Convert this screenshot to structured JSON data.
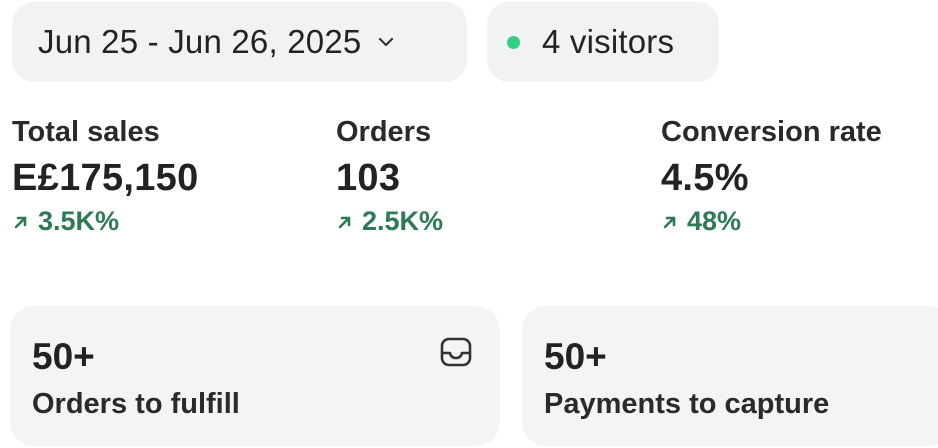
{
  "date_range": {
    "label": "Jun 25 - Jun 26, 2025",
    "icon": "chevron-down-icon"
  },
  "visitors": {
    "label": "4 visitors",
    "dot_color": "#2fcf85"
  },
  "metrics": [
    {
      "label": "Total sales",
      "value": "E£175,150",
      "change": "3.5K%",
      "trend": "up"
    },
    {
      "label": "Orders",
      "value": "103",
      "change": "2.5K%",
      "trend": "up"
    },
    {
      "label": "Conversion rate",
      "value": "4.5%",
      "change": "48%",
      "trend": "up"
    }
  ],
  "cards": [
    {
      "count": "50+",
      "label": "Orders to fulfill",
      "icon": "inbox-icon"
    },
    {
      "count": "50+",
      "label": "Payments to capture"
    }
  ],
  "colors": {
    "positive": "#2d7a55",
    "pill_bg": "#f1f2f2",
    "card_bg": "#f4f4f4"
  }
}
